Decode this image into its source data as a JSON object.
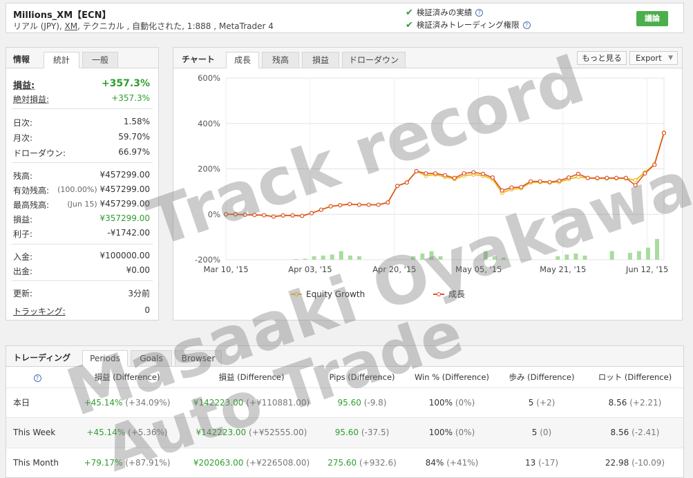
{
  "header": {
    "account_name": "Millions_XM【ECN】",
    "desc_prefix": "リアル (JPY), ",
    "desc_broker": "XM",
    "desc_suffix": ", テクニカル , 自動化された, 1:888 , MetaTrader 4",
    "verify_1": "検証済みの実績",
    "verify_2": "検証済みトレーディング権限",
    "action_button": "議論"
  },
  "info": {
    "title": "情報",
    "tabs": [
      "統計",
      "一般"
    ],
    "profit_label": "損益:",
    "profit_value": "+357.3%",
    "abs_profit_label": "絶対損益:",
    "abs_profit_value": "+357.3%",
    "daily_label": "日次:",
    "daily_value": "1.58%",
    "monthly_label": "月次:",
    "monthly_value": "59.70%",
    "drawdown_label": "ドローダウン:",
    "drawdown_value": "66.97%",
    "balance_label": "残高:",
    "balance_value": "¥457299.00",
    "equity_label": "有効残高:",
    "equity_pre": "(100.00%)",
    "equity_value": "¥457299.00",
    "highest_label": "最高残高:",
    "highest_pre": "(Jun 15)",
    "highest_value": "¥457299.00",
    "pnl_label": "損益:",
    "pnl_value": "¥357299.00",
    "interest_label": "利子:",
    "interest_value": "-¥1742.00",
    "deposit_label": "入金:",
    "deposit_value": "¥100000.00",
    "withdraw_label": "出金:",
    "withdraw_value": "¥0.00",
    "updated_label": "更新:",
    "updated_value": "3分前",
    "tracking_label": "トラッキング:",
    "tracking_value": "0"
  },
  "chart_panel": {
    "title": "チャート",
    "tabs": [
      "成長",
      "残高",
      "損益",
      "ドローダウン"
    ],
    "more_button": "もっと見る",
    "export_button": "Export",
    "export_arrow": "▼"
  },
  "chart_data": {
    "type": "line",
    "y_ticks": [
      "600%",
      "400%",
      "200%",
      "0%",
      "-200%"
    ],
    "x_ticks": [
      "Mar 10, '15",
      "Apr 03, '15",
      "Apr 20, '15",
      "May 05, '15",
      "May 21, '15",
      "Jun 12, '15"
    ],
    "ylim": [
      -200,
      600
    ],
    "grid": true,
    "legend_position": "bottom",
    "series": [
      {
        "name": "Equity Growth",
        "color": "#f0c020",
        "values": [
          0,
          0,
          -2,
          -3,
          -4,
          -10,
          -5,
          -5,
          -7,
          5,
          20,
          35,
          40,
          45,
          42,
          42,
          42,
          52,
          125,
          140,
          190,
          170,
          175,
          165,
          155,
          170,
          175,
          170,
          155,
          95,
          110,
          115,
          140,
          142,
          140,
          142,
          155,
          165,
          160,
          158,
          158,
          158,
          158,
          150,
          185,
          220,
          360
        ]
      },
      {
        "name": "成長",
        "color": "#d9542b",
        "values": [
          0,
          0,
          -2,
          -3,
          -4,
          -10,
          -5,
          -5,
          -7,
          5,
          20,
          35,
          40,
          45,
          42,
          42,
          42,
          52,
          125,
          140,
          190,
          180,
          180,
          172,
          160,
          180,
          185,
          178,
          162,
          105,
          118,
          120,
          145,
          145,
          142,
          148,
          162,
          178,
          160,
          160,
          160,
          160,
          160,
          128,
          180,
          218,
          358
        ]
      }
    ],
    "bars": [
      0,
      0,
      0,
      0,
      0,
      0,
      0,
      2,
      3,
      10,
      12,
      15,
      25,
      12,
      10,
      0,
      0,
      0,
      0,
      0,
      10,
      18,
      25,
      10,
      0,
      0,
      0,
      0,
      25,
      10,
      6,
      0,
      0,
      0,
      0,
      0,
      10,
      15,
      18,
      12,
      0,
      0,
      25,
      0,
      20,
      25,
      35,
      60
    ]
  },
  "trading": {
    "title": "トレーディング",
    "tabs": [
      "Periods",
      "Goals",
      "Browser"
    ],
    "headers": [
      "?",
      "損益 (Difference)",
      "損益 (Difference)",
      "Pips (Difference)",
      "Win % (Difference)",
      "歩み (Difference)",
      "ロット (Difference)"
    ],
    "rows": [
      {
        "period": "本日",
        "pct": "+45.14%",
        "pct_diff": "(+34.09%)",
        "amt": "¥142223.00",
        "amt_diff": "(+¥110881.00)",
        "pips": "95.60",
        "pips_diff": "(-9.8)",
        "win": "100%",
        "win_diff": "(0%)",
        "trades": "5",
        "trades_diff": "(+2)",
        "lots": "8.56",
        "lots_diff": "(+2.21)"
      },
      {
        "period": "This Week",
        "pct": "+45.14%",
        "pct_diff": "(+5.36%)",
        "amt": "¥142223.00",
        "amt_diff": "(+¥52555.00)",
        "pips": "95.60",
        "pips_diff": "(-37.5)",
        "win": "100%",
        "win_diff": "(0%)",
        "trades": "5",
        "trades_diff": "(0)",
        "lots": "8.56",
        "lots_diff": "(-2.41)"
      },
      {
        "period": "This Month",
        "pct": "+79.17%",
        "pct_diff": "(+87.91%)",
        "amt": "¥202063.00",
        "amt_diff": "(+¥226508.00)",
        "pips": "275.60",
        "pips_diff": "(+932.6)",
        "win": "84%",
        "win_diff": "(+41%)",
        "trades": "13",
        "trades_diff": "(-17)",
        "lots": "22.98",
        "lots_diff": "(-10.09)"
      }
    ]
  },
  "watermark": {
    "line1": "Track record",
    "line2": "Masaaki Oyakawa",
    "line3": "Auto Trade"
  }
}
